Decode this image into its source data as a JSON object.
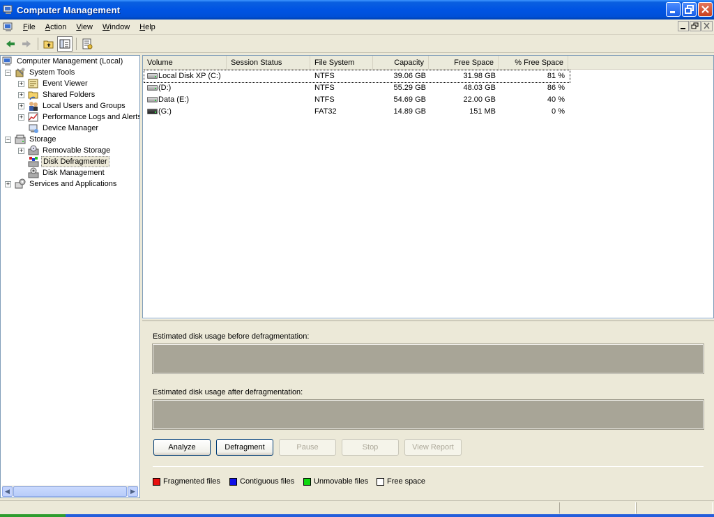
{
  "window": {
    "title": "Computer Management",
    "icon": "computer-management-icon"
  },
  "menubar": {
    "items": [
      {
        "key": "F",
        "rest": "ile"
      },
      {
        "key": "A",
        "rest": "ction"
      },
      {
        "key": "V",
        "rest": "iew"
      },
      {
        "key": "W",
        "rest": "indow"
      },
      {
        "key": "H",
        "rest": "elp"
      }
    ]
  },
  "tree": {
    "root": "Computer Management (Local)",
    "system_tools": "System Tools",
    "event_viewer": "Event Viewer",
    "shared_folders": "Shared Folders",
    "local_users": "Local Users and Groups",
    "perf_logs": "Performance Logs and Alerts",
    "device_manager": "Device Manager",
    "storage": "Storage",
    "removable_storage": "Removable Storage",
    "disk_defragmenter": "Disk Defragmenter",
    "disk_management": "Disk Management",
    "services_apps": "Services and Applications"
  },
  "volume_list": {
    "columns": [
      "Volume",
      "Session Status",
      "File System",
      "Capacity",
      "Free Space",
      "% Free Space"
    ],
    "rows": [
      {
        "volume": "Local Disk XP (C:)",
        "status": "",
        "fs": "NTFS",
        "capacity": "39.06 GB",
        "free": "31.98 GB",
        "pct": "81 %"
      },
      {
        "volume": "(D:)",
        "status": "",
        "fs": "NTFS",
        "capacity": "55.29 GB",
        "free": "48.03 GB",
        "pct": "86 %"
      },
      {
        "volume": "Data (E:)",
        "status": "",
        "fs": "NTFS",
        "capacity": "54.69 GB",
        "free": "22.00 GB",
        "pct": "40 %"
      },
      {
        "volume": "(G:)",
        "status": "",
        "fs": "FAT32",
        "capacity": "14.89 GB",
        "free": "151 MB",
        "pct": "0 %"
      }
    ]
  },
  "defrag": {
    "before_label": "Estimated disk usage before defragmentation:",
    "after_label": "Estimated disk usage after defragmentation:",
    "buttons": {
      "analyze": "Analyze",
      "defragment": "Defragment",
      "pause": "Pause",
      "stop": "Stop",
      "view_report": "View Report"
    },
    "legend": [
      {
        "label": "Fragmented files",
        "color": "#e81010"
      },
      {
        "label": "Contiguous files",
        "color": "#1010e8"
      },
      {
        "label": "Unmovable files",
        "color": "#10d810"
      },
      {
        "label": "Free space",
        "color": "#ffffff"
      }
    ]
  }
}
